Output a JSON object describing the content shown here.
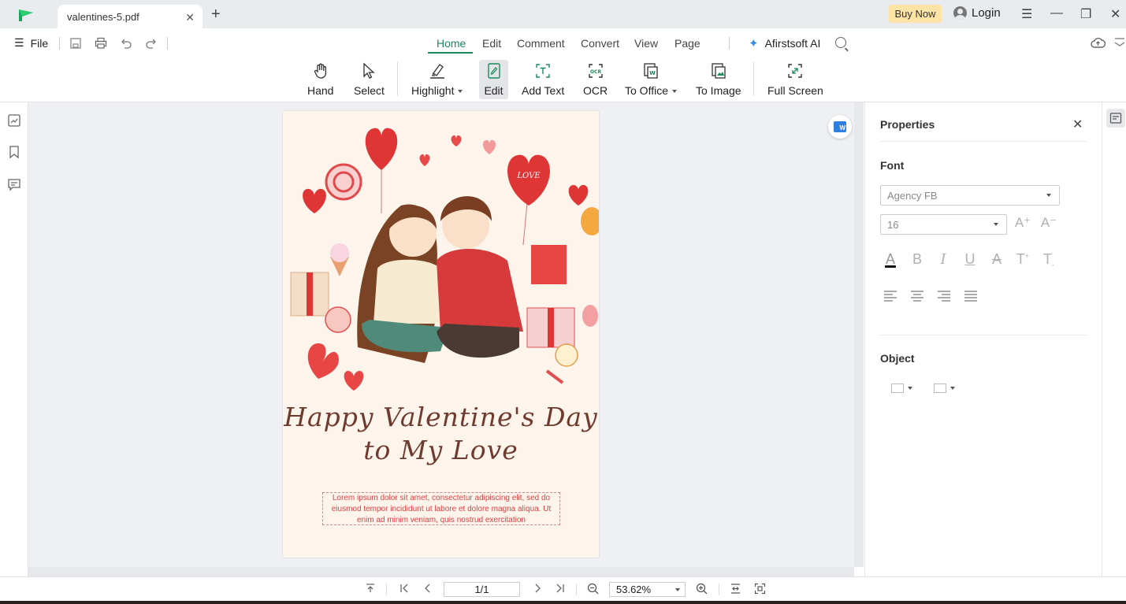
{
  "tab": {
    "title": "valentines-5.pdf"
  },
  "titlebar": {
    "buy_now": "Buy Now",
    "login": "Login"
  },
  "menu": {
    "file": "File",
    "tabs": [
      "Home",
      "Edit",
      "Comment",
      "Convert",
      "View",
      "Page"
    ],
    "active_tab": "Home",
    "ai": "Afirstsoft AI"
  },
  "ribbon": {
    "hand": "Hand",
    "select": "Select",
    "highlight": "Highlight",
    "edit": "Edit",
    "add_text": "Add Text",
    "ocr": "OCR",
    "to_office": "To Office",
    "to_image": "To Image",
    "full_screen": "Full Screen"
  },
  "document": {
    "title_line1": "Happy Valentine's Day",
    "title_line2": "to My Love",
    "balloon_text": "LOVE",
    "body_text": "Lorem ipsum dolor sit amet, consectetur adipiscing elit, sed do eiusmod tempor incididunt ut labore et dolore magna aliqua. Ut enim ad minim veniam, quis nostrud exercitation"
  },
  "properties": {
    "title": "Properties",
    "font_section": "Font",
    "font_family": "Agency FB",
    "font_size": "16",
    "object_section": "Object"
  },
  "statusbar": {
    "page": "1/1",
    "zoom": "53.62%"
  },
  "colors": {
    "accent": "#1a8a5a",
    "buy_now_bg": "#fde3a5",
    "canvas_bg": "#eef0f3"
  }
}
